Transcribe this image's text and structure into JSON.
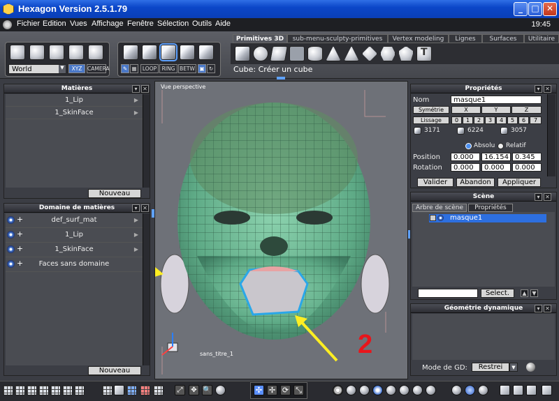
{
  "window": {
    "title": "Hexagon Version 2.5.1.79",
    "min": "_",
    "max": "□",
    "close": "✕"
  },
  "menu": {
    "items": [
      "Fichier",
      "Edition",
      "Vues",
      "Affichage",
      "Fenêtre",
      "Sélection",
      "Outils",
      "Aide"
    ],
    "clock": "19:45"
  },
  "toolbar": {
    "world": "World",
    "xyz": "XYZ",
    "camera": "CAMERA",
    "loop": "LOOP",
    "ring": "RING",
    "betw": "BETW",
    "tabs": [
      "Primitives 3D",
      "sub-menu-sculpty-primitives",
      "Vertex modeling",
      "Lignes",
      "Surfaces",
      "Utilitaire"
    ],
    "status": "Cube: Créer un cube"
  },
  "materials": {
    "title": "Matières",
    "items": [
      "1_Lip",
      "1_SkinFace"
    ],
    "new_button": "Nouveau"
  },
  "domains": {
    "title": "Domaine de matières",
    "items": [
      "def_surf_mat",
      "1_Lip",
      "1_SkinFace",
      "Faces sans domaine"
    ],
    "new_button": "Nouveau"
  },
  "viewport": {
    "label": "Vue perspective",
    "object_label": "sans_titre_1",
    "annotation": "2"
  },
  "properties": {
    "title": "Propriétés",
    "name_label": "Nom",
    "name_value": "masque1",
    "symmetry": "Symétrie",
    "axes": [
      "X",
      "Y",
      "Z"
    ],
    "smoothing": "Lissage",
    "levels": [
      "0",
      "1",
      "2",
      "3",
      "4",
      "5",
      "6",
      "7"
    ],
    "counts": [
      "3171",
      "6224",
      "3057"
    ],
    "absolute": "Absolu",
    "relative": "Relatif",
    "position_label": "Position",
    "position": [
      "0.000",
      "16.154",
      "0.345"
    ],
    "rotation_label": "Rotation",
    "rotation": [
      "0.000",
      "0.000",
      "0.000"
    ],
    "validate": "Valider",
    "cancel": "Abandon",
    "apply": "Appliquer"
  },
  "scene": {
    "title": "Scène",
    "tabs": [
      "Arbre de scène",
      "Propriétés"
    ],
    "item": "masque1",
    "select_button": "Select."
  },
  "dyngeo": {
    "title": "Géométrie dynamique",
    "mode_label": "Mode de GD:",
    "mode_value": "Restrei"
  }
}
